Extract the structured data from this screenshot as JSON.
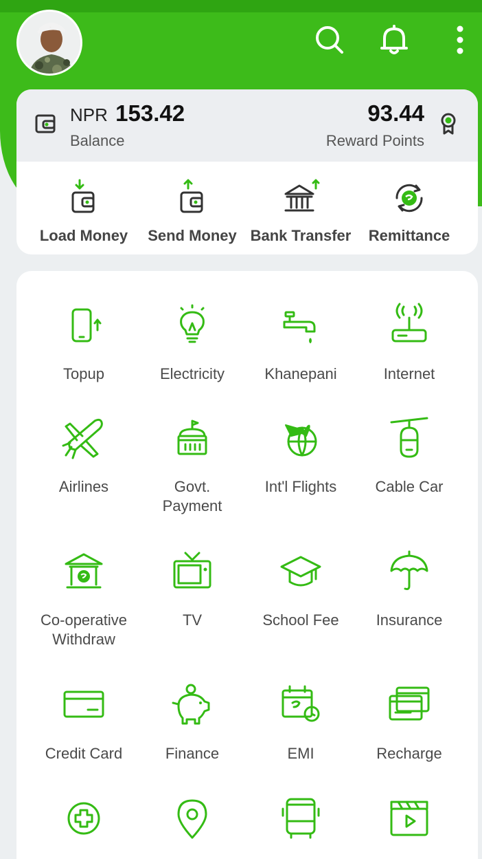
{
  "colors": {
    "brand": "#3dbb1a",
    "icon": "#34bb14",
    "background": "#eceff1"
  },
  "header": {
    "icons": [
      "search-icon",
      "bell-icon",
      "more-vertical-icon"
    ]
  },
  "balance": {
    "currency": "NPR",
    "amount": "153.42",
    "label": "Balance",
    "reward_points": "93.44",
    "reward_label": "Reward Points"
  },
  "quick_actions": [
    {
      "label": "Load Money",
      "icon": "load-money-icon"
    },
    {
      "label": "Send Money",
      "icon": "send-money-icon"
    },
    {
      "label": "Bank Transfer",
      "icon": "bank-transfer-icon"
    },
    {
      "label": "Remittance",
      "icon": "remittance-icon"
    }
  ],
  "services": [
    {
      "label": "Topup",
      "icon": "phone-topup-icon"
    },
    {
      "label": "Electricity",
      "icon": "bulb-icon"
    },
    {
      "label": "Khanepani",
      "icon": "water-tap-icon"
    },
    {
      "label": "Internet",
      "icon": "router-icon"
    },
    {
      "label": "Airlines",
      "icon": "airplane-icon"
    },
    {
      "label": "Govt.\nPayment",
      "icon": "government-icon"
    },
    {
      "label": "Int'l Flights",
      "icon": "globe-plane-icon"
    },
    {
      "label": "Cable Car",
      "icon": "cable-car-icon"
    },
    {
      "label": "Co-operative\nWithdraw",
      "icon": "cooperative-icon"
    },
    {
      "label": "TV",
      "icon": "tv-icon"
    },
    {
      "label": "School Fee",
      "icon": "graduation-cap-icon"
    },
    {
      "label": "Insurance",
      "icon": "umbrella-icon"
    },
    {
      "label": "Credit Card",
      "icon": "credit-card-icon"
    },
    {
      "label": "Finance",
      "icon": "piggy-bank-icon"
    },
    {
      "label": "EMI",
      "icon": "calendar-clock-icon"
    },
    {
      "label": "Recharge",
      "icon": "recharge-cards-icon"
    },
    {
      "label": "",
      "icon": "medical-plus-icon"
    },
    {
      "label": "",
      "icon": "location-pin-icon"
    },
    {
      "label": "",
      "icon": "bus-icon"
    },
    {
      "label": "",
      "icon": "movie-clapper-icon"
    }
  ]
}
